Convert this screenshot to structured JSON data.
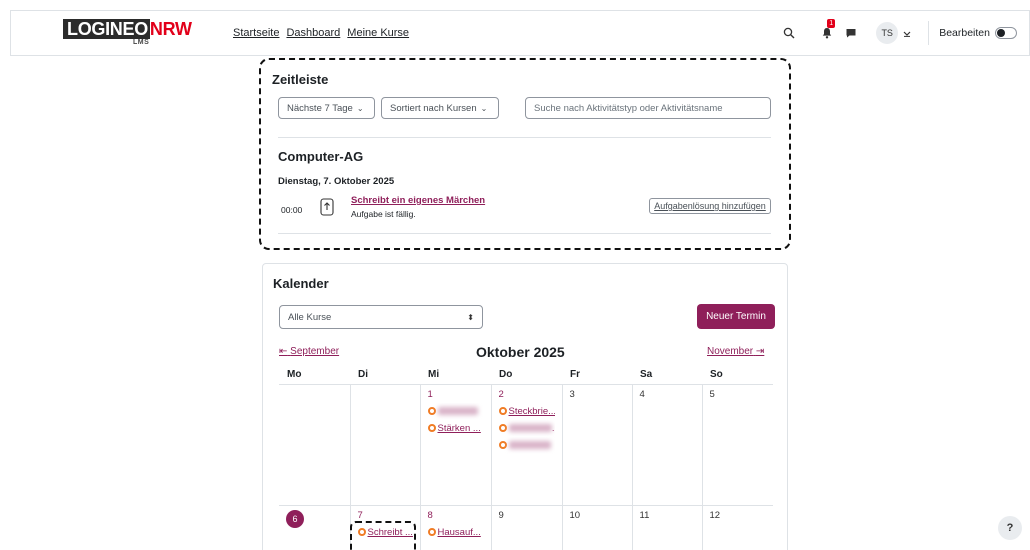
{
  "logo": {
    "part_a": "LOGINEO",
    "part_b": "NRW",
    "sub": "LMS"
  },
  "nav": {
    "links": [
      "Startseite",
      "Dashboard",
      "Meine Kurse"
    ],
    "notification_count": "1",
    "avatar_initials": "TS",
    "edit_label": "Bearbeiten"
  },
  "timeline": {
    "title": "Zeitleiste",
    "filter_label": "Nächste 7 Tage",
    "sort_label": "Sortiert nach Kursen",
    "search_placeholder": "Suche nach Aktivitätstyp oder Aktivitätsname",
    "course": "Computer-AG",
    "date": "Dienstag, 7. Oktober 2025",
    "time": "00:00",
    "event_name": "Schreibt ein eigenes Märchen",
    "event_sub": "Aufgabe ist fällig.",
    "action_label": "Aufgabenlösung hinzufügen"
  },
  "calendar": {
    "title": "Kalender",
    "course_select": "Alle Kurse",
    "new_event_label": "Neuer Termin",
    "prev_month": "September",
    "month_title": "Oktober 2025",
    "next_month": "November",
    "weekdays": [
      "Mo",
      "Di",
      "Mi",
      "Do",
      "Fr",
      "Sa",
      "So"
    ],
    "week1": {
      "d1": "1",
      "d2": "2",
      "d3": "3",
      "d4": "4",
      "d5": "5",
      "ev_mi_2": "Stärken ...",
      "ev_do_1": "Steckbrie...",
      "ev_do_2_suffix": "."
    },
    "week2": {
      "d6": "6",
      "d7": "7",
      "d8": "8",
      "d9": "9",
      "d10": "10",
      "d11": "11",
      "d12": "12",
      "ev_di": "Schreibt ...",
      "ev_mi": "Hausauf..."
    }
  },
  "help_label": "?",
  "colors": {
    "accent": "#8f1f5a",
    "event_dot": "#f07c25",
    "badge": "#e2001a"
  }
}
